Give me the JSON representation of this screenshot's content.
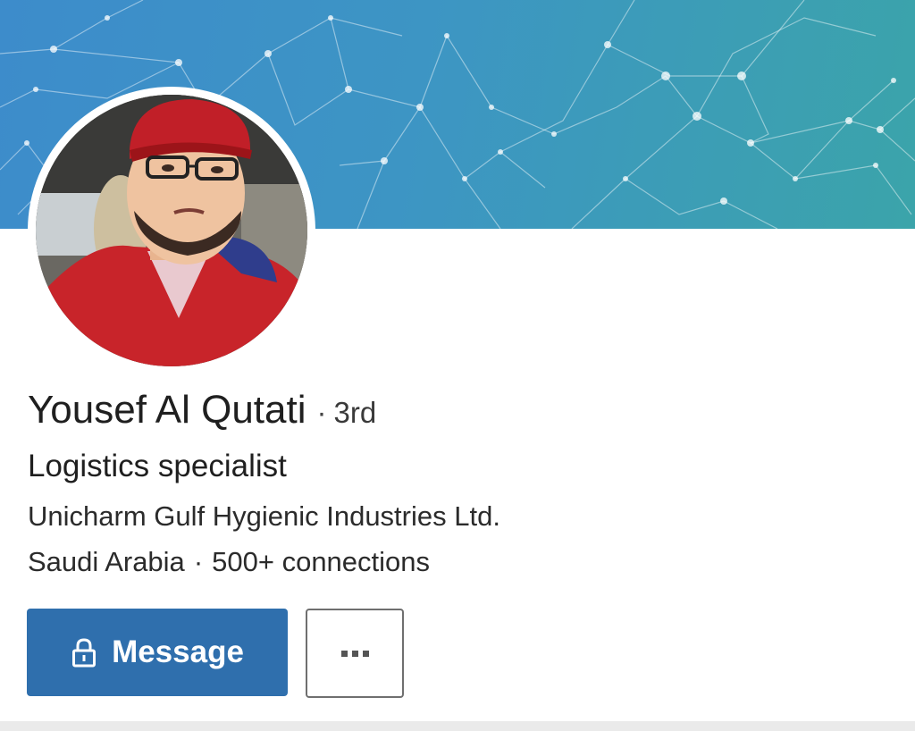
{
  "profile": {
    "name": "Yousef Al Qutati",
    "degree_separator": "·",
    "degree": "3rd",
    "headline": "Logistics specialist",
    "company": "Unicharm Gulf Hygienic Industries Ltd.",
    "location": "Saudi Arabia",
    "meta_separator": "·",
    "connections": "500+ connections"
  },
  "actions": {
    "message_label": "Message",
    "message_icon": "lock-icon",
    "more_icon": "ellipsis-icon"
  },
  "colors": {
    "banner_start": "#3d8ccb",
    "banner_end": "#3ba4aa",
    "primary_button": "#2f6fad"
  }
}
